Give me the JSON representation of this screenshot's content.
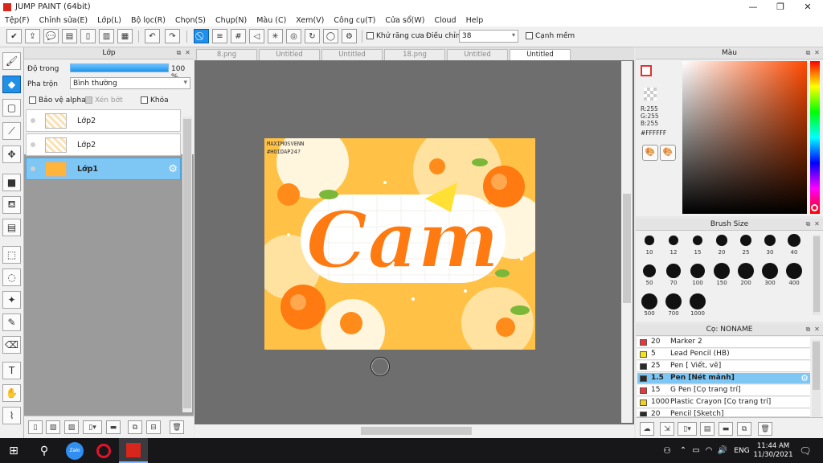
{
  "window": {
    "title": "JUMP PAINT (64bit)"
  },
  "menu": [
    "Tệp(F)",
    "Chỉnh sửa(E)",
    "Lớp(L)",
    "Bộ lọc(R)",
    "Chọn(S)",
    "Chụp(N)",
    "Màu (C)",
    "Xem(V)",
    "Công cụ(T)",
    "Cửa sổ(W)",
    "Cloud",
    "Help"
  ],
  "toolbar": {
    "antialias_label": "Khử răng cưa",
    "adjust_label": "Điều chỉnh",
    "adjust_value": "38",
    "sharp_edge_label": "Cạnh mềm"
  },
  "layers": {
    "title": "Lớp",
    "opacity_label": "Độ trong",
    "opacity_value": "100 %",
    "opacity_percent": 100,
    "blend_label": "Pha trộn",
    "blend_value": "Bình thường",
    "protect_alpha_label": "Bảo vệ alpha",
    "clip_label": "Xén bớt",
    "lock_label": "Khóa",
    "items": [
      {
        "name": "Lớp2",
        "selected": false
      },
      {
        "name": "Lớp2",
        "selected": false
      },
      {
        "name": "Lớp1",
        "selected": true
      }
    ]
  },
  "tabs": [
    {
      "label": "8.png",
      "active": false
    },
    {
      "label": "Untitled",
      "active": false
    },
    {
      "label": "Untitled",
      "active": false
    },
    {
      "label": "18.png",
      "active": false
    },
    {
      "label": "Untitled",
      "active": false
    },
    {
      "label": "Untitled",
      "active": true
    }
  ],
  "artwork": {
    "main_text": "Cam",
    "signature_line1": "MAXIMOSVENN",
    "signature_line2": "#HOIDAP24?"
  },
  "color": {
    "title": "Màu",
    "r": "R:255",
    "g": "G:255",
    "b": "B:255",
    "hex": "#FFFFFF",
    "hue_color": "#ff4a00"
  },
  "brush_size": {
    "title": "Brush Size",
    "sizes": [
      "10",
      "12",
      "15",
      "20",
      "25",
      "30",
      "40",
      "50",
      "70",
      "100",
      "150",
      "200",
      "300",
      "400",
      "500",
      "700",
      "1000"
    ]
  },
  "brushes": {
    "title": "Cọ: NONAME",
    "items": [
      {
        "size": "20",
        "name": "Marker 2",
        "color": "#e8383c",
        "selected": false
      },
      {
        "size": "5",
        "name": "Lead Pencil (HB)",
        "color": "#f2e21c",
        "selected": false
      },
      {
        "size": "25",
        "name": "Pen [ Viết, vẽ]",
        "color": "#2a2a2a",
        "selected": false
      },
      {
        "size": "1.5",
        "name": "Pen [Nét mảnh]",
        "color": "#2a2a2a",
        "selected": true
      },
      {
        "size": "15",
        "name": "G Pen [Cọ trang trí]",
        "color": "#e8383c",
        "selected": false
      },
      {
        "size": "1000",
        "name": "Plastic Crayon [Cọ trang trí]",
        "color": "#f2d21c",
        "selected": false
      },
      {
        "size": "20",
        "name": "Pencil [Sketch]",
        "color": "#2a2a2a",
        "selected": false
      }
    ]
  },
  "taskbar": {
    "lang": "ENG",
    "time": "11:44 AM",
    "date": "11/30/2021",
    "zalo_label": "Zalo"
  }
}
